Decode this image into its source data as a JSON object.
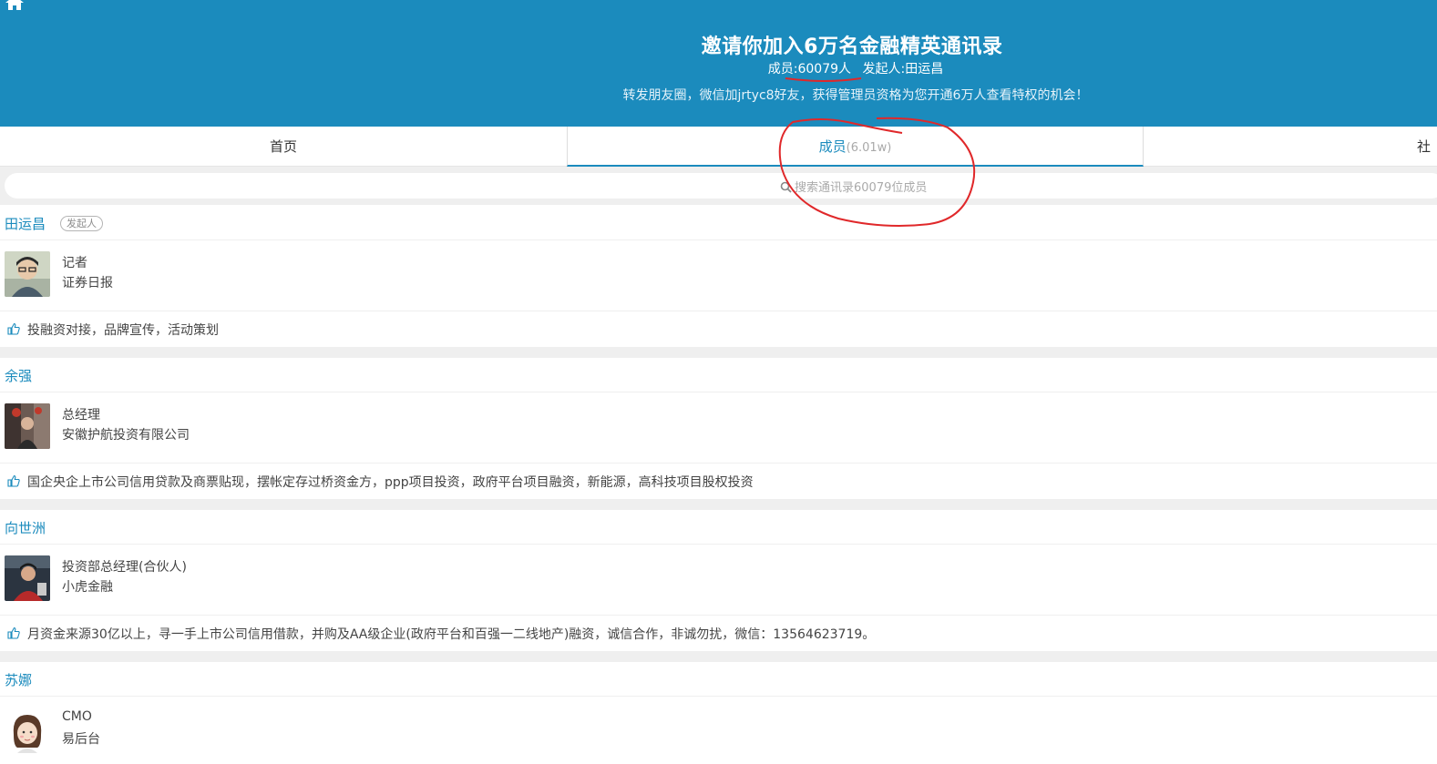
{
  "header": {
    "title": "邀请你加入6万名金融精英通讯录",
    "members_label": "成员:60079人",
    "founder_label": "发起人:田运昌",
    "notice": "转发朋友圈，微信加jrtyc8好友，获得管理员资格为您开通6万人查看特权的机会！",
    "icon": "home-icon"
  },
  "tabs": {
    "home": "首页",
    "members": "成员",
    "members_count": "(6.01w)",
    "third": "社"
  },
  "search": {
    "placeholder": "搜索通讯录60079位成员"
  },
  "members": [
    {
      "name": "田运昌",
      "badge": "发起人",
      "title": "记者",
      "company": "证券日报",
      "tags": "投融资对接，品牌宣传，活动策划"
    },
    {
      "name": "余强",
      "title": "总经理",
      "company": "安徽护航投资有限公司",
      "tags": "国企央企上市公司信用贷款及商票贴现，摆帐定存过桥资金方，ppp项目投资，政府平台项目融资，新能源，高科技项目股权投资"
    },
    {
      "name": "向世洲",
      "title": "投资部总经理(合伙人)",
      "company": "小虎金融",
      "tags": "月资金来源30亿以上，寻一手上市公司信用借款，并购及AA级企业(政府平台和百强一二线地产)融资，诚信合作，非诚勿扰，微信：13564623719。"
    },
    {
      "name": "苏娜",
      "title": "CMO",
      "company": "易后台"
    }
  ],
  "colors": {
    "brand": "#1b8bbd",
    "annotation": "#e0282a"
  }
}
